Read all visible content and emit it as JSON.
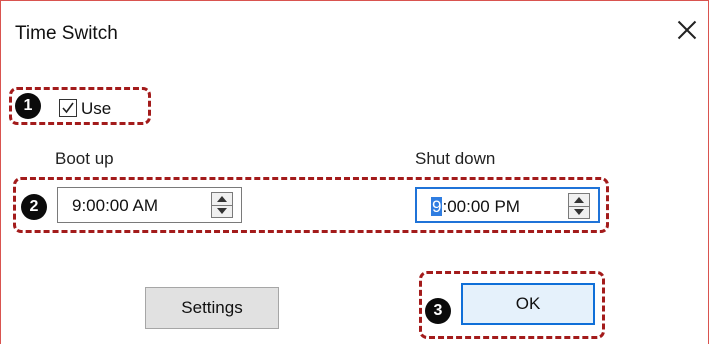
{
  "dialog": {
    "title": "Time Switch"
  },
  "use": {
    "label": "Use",
    "checked": true
  },
  "boot_up": {
    "label": "Boot up",
    "value": "9:00:00 AM"
  },
  "shut_down": {
    "label": "Shut down",
    "selected_part": "9",
    "rest": ":00:00 PM"
  },
  "buttons": {
    "settings": "Settings",
    "ok": "OK"
  },
  "callouts": {
    "one": "1",
    "two": "2",
    "three": "3"
  },
  "colors": {
    "callout_border": "#a31b1b",
    "focus_blue": "#1f73d8"
  },
  "icons": {
    "close": "close-icon",
    "spin_up": "chevron-up-icon",
    "spin_down": "chevron-down-icon",
    "checkbox": "checkmark-icon"
  }
}
